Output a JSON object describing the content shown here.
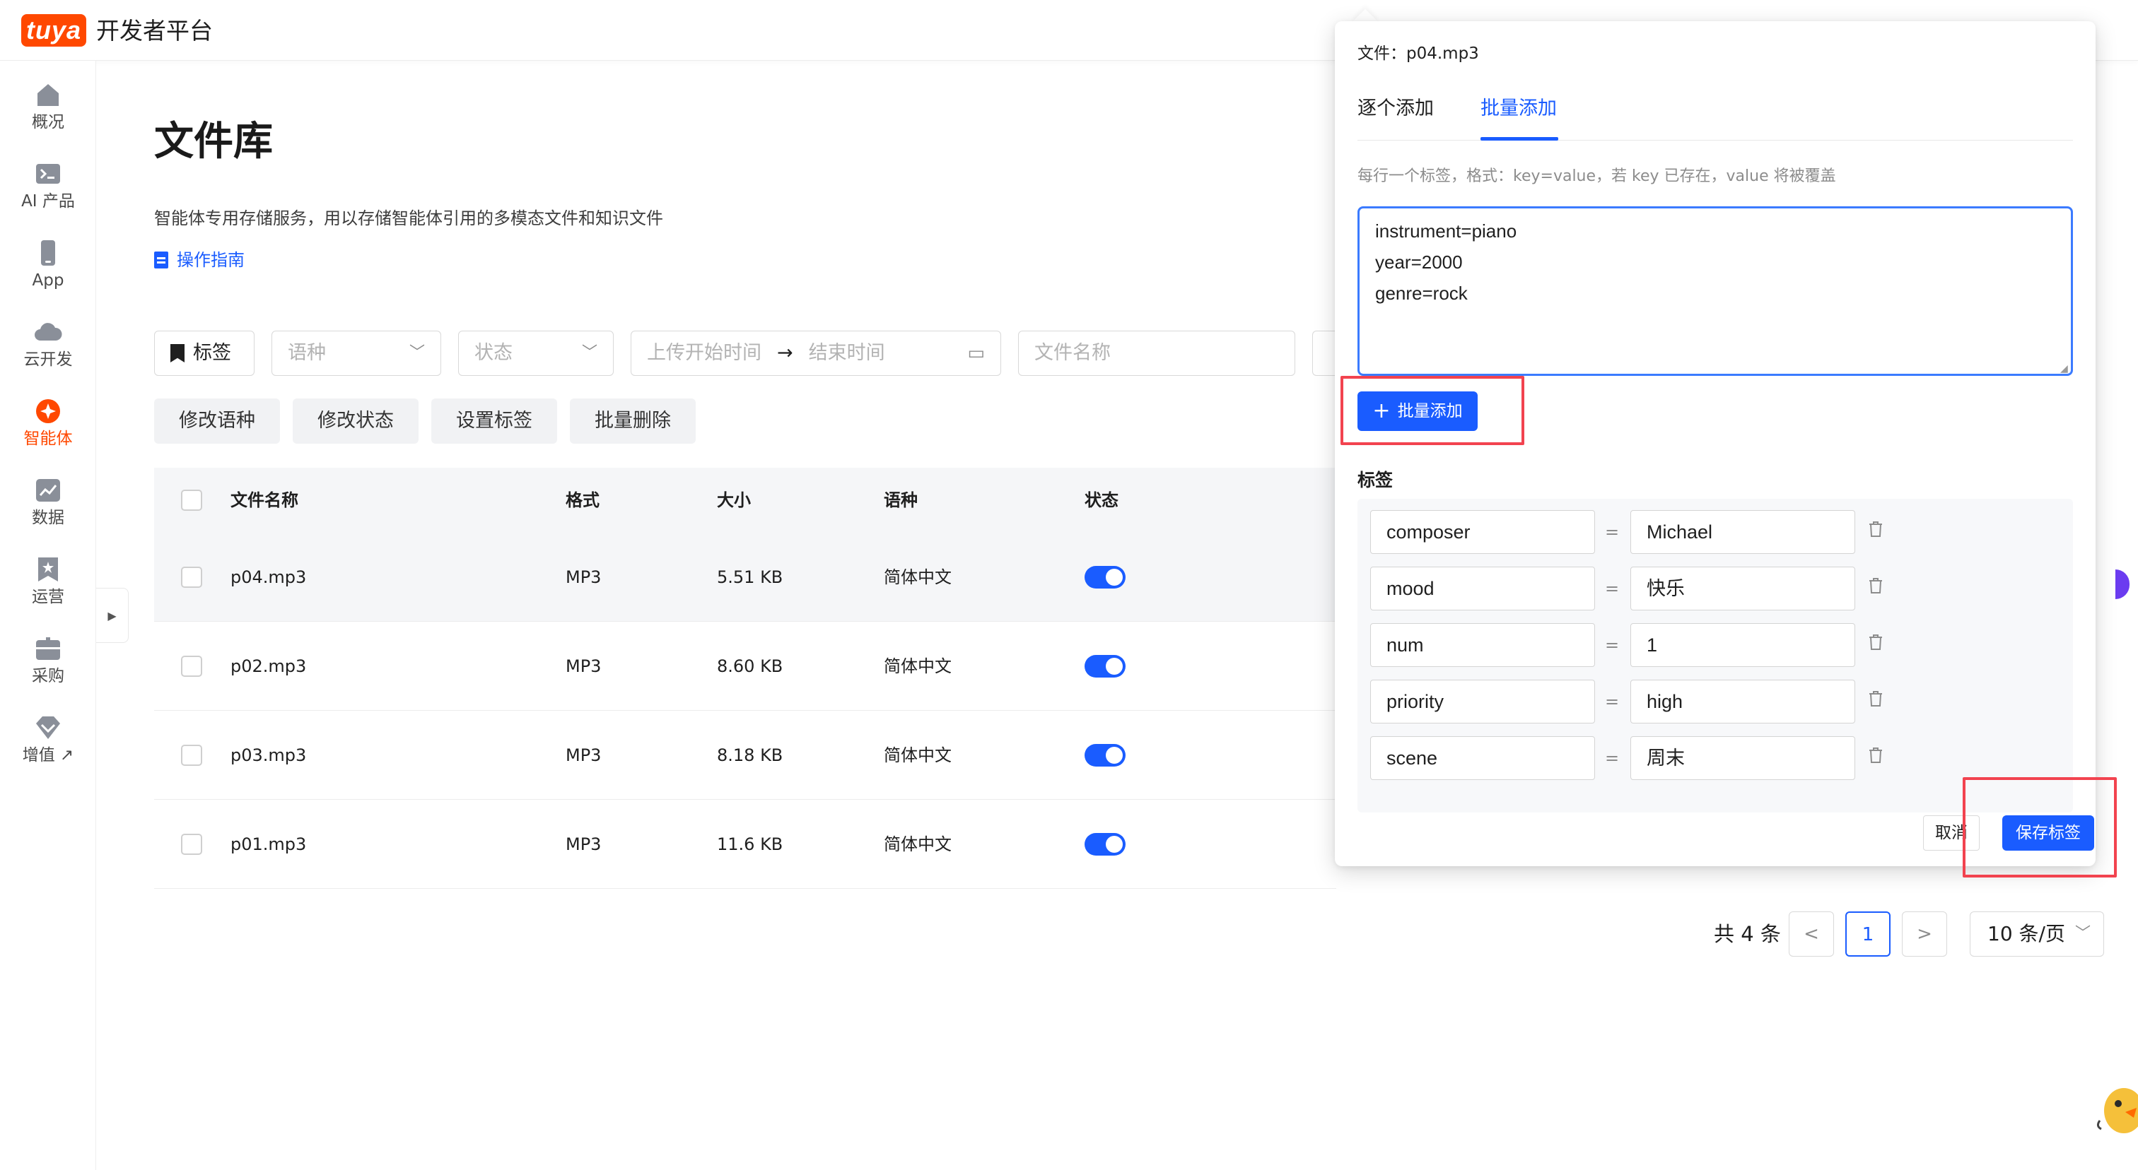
{
  "header": {
    "logo_text": "tuya",
    "platform_title": "开发者平台"
  },
  "sidebar": {
    "items": [
      {
        "label": "概况",
        "icon": "home-icon"
      },
      {
        "label": "AI 产品",
        "icon": "terminal-icon"
      },
      {
        "label": "App",
        "icon": "phone-icon"
      },
      {
        "label": "云开发",
        "icon": "cloud-icon"
      },
      {
        "label": "智能体",
        "icon": "agent-icon",
        "active": true
      },
      {
        "label": "数据",
        "icon": "chart-icon"
      },
      {
        "label": "运营",
        "icon": "star-icon"
      },
      {
        "label": "采购",
        "icon": "box-icon"
      },
      {
        "label": "增值",
        "icon": "gem-icon",
        "suffix": "↗"
      }
    ]
  },
  "page": {
    "title": "文件库",
    "description": "智能体专用存储服务，用以存储智能体引用的多模态文件和知识文件",
    "guide_link": "操作指南"
  },
  "filters": {
    "tag_button": "标签",
    "language_placeholder": "语种",
    "status_placeholder": "状态",
    "start_time_placeholder": "上传开始时间",
    "end_time_placeholder": "结束时间",
    "filename_placeholder": "文件名称"
  },
  "actions": {
    "modify_language": "修改语种",
    "modify_status": "修改状态",
    "set_tags": "设置标签",
    "batch_delete": "批量删除"
  },
  "table": {
    "headers": {
      "filename": "文件名称",
      "format": "格式",
      "size": "大小",
      "language": "语种",
      "status": "状态"
    },
    "rows": [
      {
        "filename": "p04.mp3",
        "format": "MP3",
        "size": "5.51 KB",
        "language": "简体中文",
        "enabled": true
      },
      {
        "filename": "p02.mp3",
        "format": "MP3",
        "size": "8.60 KB",
        "language": "简体中文",
        "enabled": true
      },
      {
        "filename": "p03.mp3",
        "format": "MP3",
        "size": "8.18 KB",
        "language": "简体中文",
        "enabled": true
      },
      {
        "filename": "p01.mp3",
        "format": "MP3",
        "size": "11.6 KB",
        "language": "简体中文",
        "enabled": true
      }
    ]
  },
  "pagination": {
    "total": "共 4 条",
    "prev": "<",
    "current_page": "1",
    "next": ">",
    "page_size": "10 条/页"
  },
  "popover": {
    "file_label": "文件：p04.mp3",
    "tabs": [
      "逐个添加",
      "批量添加"
    ],
    "active_tab": "批量添加",
    "hint": "每行一个标签，格式：key=value，若 key 已存在，value 将被覆盖",
    "bulk_text": "instrument=piano\nyear=2000\ngenre=rock",
    "bulk_add_button": "批量添加",
    "tags_title": "标签",
    "tags": [
      {
        "key": "composer",
        "value": "Michael"
      },
      {
        "key": "mood",
        "value": "快乐"
      },
      {
        "key": "num",
        "value": "1"
      },
      {
        "key": "priority",
        "value": "high"
      },
      {
        "key": "scene",
        "value": "周末"
      }
    ],
    "equals_sign": "=",
    "cancel_button": "取消",
    "save_button": "保存标签"
  },
  "colors": {
    "brand": "#ff4800",
    "primary": "#1a5cff",
    "highlight_box": "#f2434f"
  }
}
